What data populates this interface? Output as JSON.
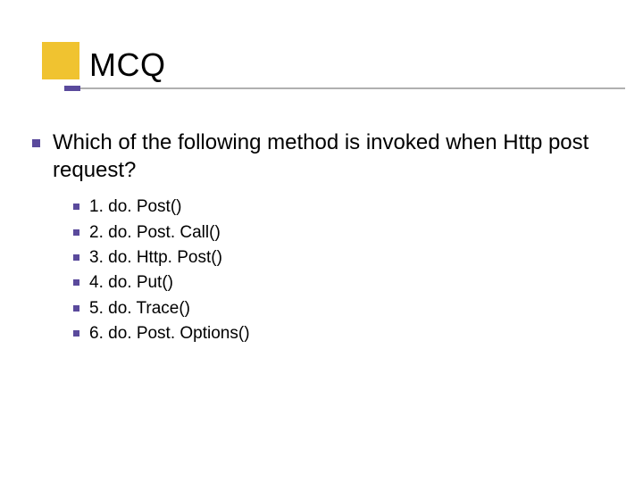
{
  "title": "MCQ",
  "question": "Which of the following method is invoked when Http post request?",
  "options": [
    "1. do. Post()",
    "2. do. Post. Call()",
    "3. do. Http. Post()",
    "4. do. Put()",
    "5. do. Trace()",
    "6. do. Post. Options()"
  ],
  "colors": {
    "accent_yellow": "#f0c330",
    "accent_purple": "#5a4a9c",
    "rule_gray": "#b0b0b0"
  }
}
